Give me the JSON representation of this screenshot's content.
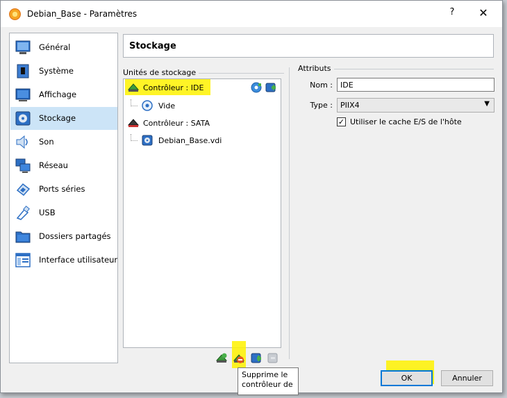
{
  "window": {
    "title": "Debian_Base - Paramètres",
    "help": "?",
    "close": "✕"
  },
  "sidebar": {
    "items": [
      {
        "label": "Général",
        "icon": "general-icon"
      },
      {
        "label": "Système",
        "icon": "system-icon"
      },
      {
        "label": "Affichage",
        "icon": "display-icon"
      },
      {
        "label": "Stockage",
        "icon": "storage-icon",
        "selected": true
      },
      {
        "label": "Son",
        "icon": "audio-icon"
      },
      {
        "label": "Réseau",
        "icon": "network-icon"
      },
      {
        "label": "Ports séries",
        "icon": "serial-ports-icon"
      },
      {
        "label": "USB",
        "icon": "usb-icon"
      },
      {
        "label": "Dossiers partagés",
        "icon": "shared-folders-icon"
      },
      {
        "label": "Interface utilisateur",
        "icon": "user-interface-icon"
      }
    ]
  },
  "page": {
    "title": "Stockage"
  },
  "storage": {
    "group_label": "Unités de stockage",
    "tree": [
      {
        "label": "Contrôleur : IDE",
        "level": 0,
        "icon": "ide-controller-icon"
      },
      {
        "label": "Vide",
        "level": 1,
        "icon": "optical-disk-icon"
      },
      {
        "label": "Contrôleur : SATA",
        "level": 0,
        "icon": "sata-controller-icon"
      },
      {
        "label": "Debian_Base.vdi",
        "level": 1,
        "icon": "hard-disk-icon"
      }
    ]
  },
  "attributes": {
    "group_label": "Attributs",
    "name_label": "Nom :",
    "name_value": "IDE",
    "type_label": "Type :",
    "type_value": "PIIX4",
    "cache_label": "Utiliser le cache E/S de l'hôte",
    "cache_checked": true
  },
  "tooltip": {
    "line1": "Supprime le",
    "line2": "contrôleur de"
  },
  "buttons": {
    "ok": "OK",
    "cancel": "Annuler"
  },
  "colors": {
    "highlight": "#fff200",
    "selection": "#cce4f7",
    "accent": "#0078d7"
  }
}
